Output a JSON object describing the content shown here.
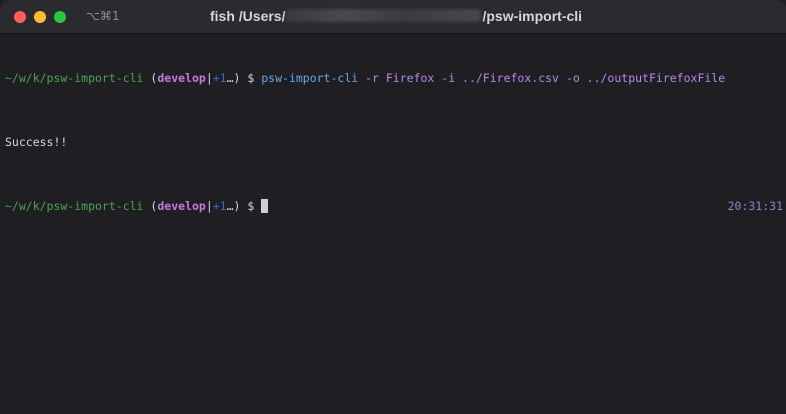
{
  "window": {
    "shortcut": "⌥⌘1",
    "title_prefix": "fish /Users/",
    "title_suffix": "/psw-import-cli",
    "colors": {
      "close": "#ff5f57",
      "minimize": "#febc2e",
      "zoom": "#28c840"
    }
  },
  "terminal": {
    "line1": {
      "path": "~/w/k/psw-import-cli",
      "open_paren": " (",
      "branch": "develop",
      "separator": "|",
      "dirty": "+1",
      "close_paren": "…)",
      "prompt": " $ ",
      "command": "psw-import-cli",
      "args": " -r Firefox -i ../Firefox.csv -o ../outputFirefoxFile"
    },
    "line2": {
      "output": "Success!!"
    },
    "line3": {
      "path": "~/w/k/psw-import-cli",
      "open_paren": " (",
      "branch": "develop",
      "separator": "|",
      "dirty": "+1",
      "close_paren": "…)",
      "prompt": " $ ",
      "time": "20:31:31"
    }
  }
}
